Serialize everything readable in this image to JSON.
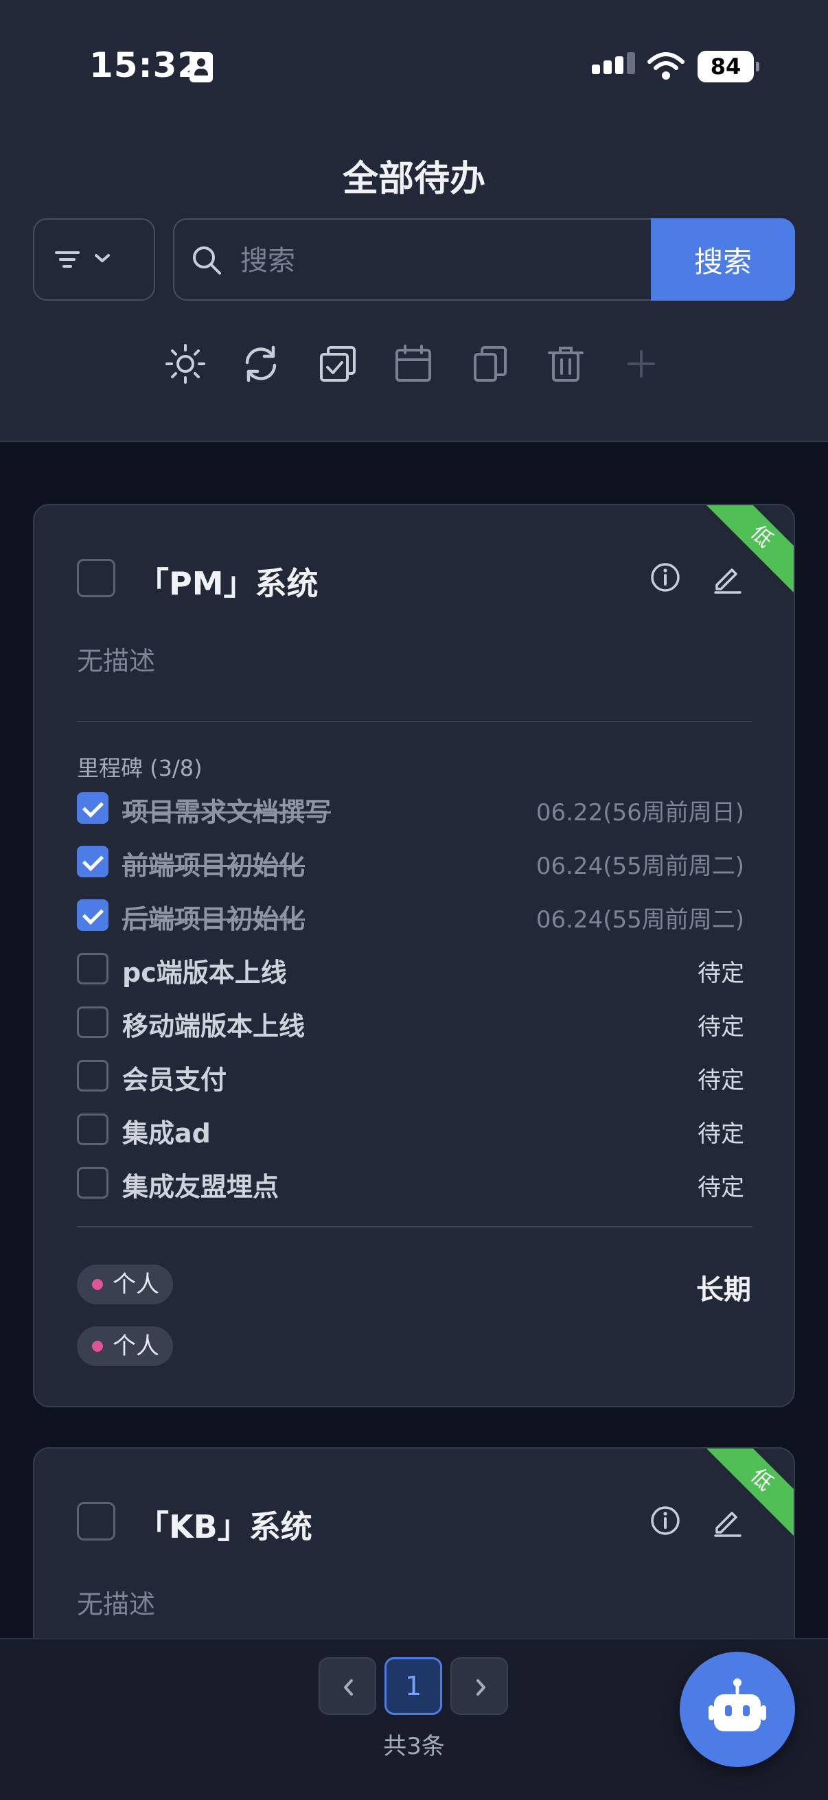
{
  "status_bar": {
    "time": "15:32",
    "battery": "84"
  },
  "header": {
    "title": "全部待办",
    "search_placeholder": "搜索",
    "search_button": "搜索"
  },
  "toolbar": {
    "icons": [
      "sun-icon",
      "refresh-icon",
      "multi-select-icon",
      "calendar-icon",
      "copy-icon",
      "trash-icon",
      "plus-icon"
    ]
  },
  "cards": [
    {
      "title": "「PM」系统",
      "priority": "低",
      "description": "无描述",
      "milestone_header": "里程碑 (3/8)",
      "milestones": [
        {
          "label": "项目需求文档撰写",
          "date": "06.22(56周前周日)",
          "done": true
        },
        {
          "label": "前端项目初始化",
          "date": "06.24(55周前周二)",
          "done": true
        },
        {
          "label": "后端项目初始化",
          "date": "06.24(55周前周二)",
          "done": true
        },
        {
          "label": "pc端版本上线",
          "date": "待定",
          "done": false
        },
        {
          "label": "移动端版本上线",
          "date": "待定",
          "done": false
        },
        {
          "label": "会员支付",
          "date": "待定",
          "done": false
        },
        {
          "label": "集成ad",
          "date": "待定",
          "done": false
        },
        {
          "label": "集成友盟埋点",
          "date": "待定",
          "done": false
        }
      ],
      "tags": [
        "个人",
        "个人"
      ],
      "term": "长期"
    },
    {
      "title": "「KB」系统",
      "priority": "低",
      "description": "无描述"
    }
  ],
  "pagination": {
    "current": "1",
    "total": "共3条"
  },
  "colors": {
    "accent": "#4c7de6",
    "priority_low": "#4fbf56",
    "tag_dot": "#e0559a"
  }
}
